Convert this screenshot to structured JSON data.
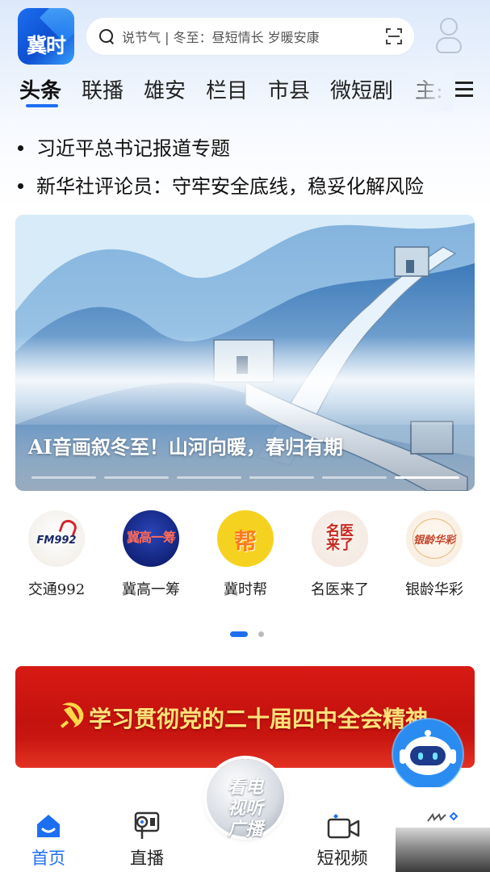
{
  "header": {
    "logo_text": "冀时",
    "search_placeholder": "说节气 | 冬至：昼短情长 岁暖安康",
    "search_icon": "search-icon",
    "scan_icon": "scan-icon",
    "profile_icon": "user-icon"
  },
  "tabs": [
    {
      "label": "头条",
      "active": true
    },
    {
      "label": "联播"
    },
    {
      "label": "雄安"
    },
    {
      "label": "栏目"
    },
    {
      "label": "市县"
    },
    {
      "label": "微短剧"
    },
    {
      "label": "主:"
    }
  ],
  "headlines": [
    "习近平总书记报道专题",
    "新华社评论员：守牢安全底线，稳妥化解风险"
  ],
  "banner": {
    "caption": "AI音画叙冬至！山河向暖，春归有期",
    "slides_total": 6,
    "active_slide": 6
  },
  "channels": [
    {
      "label": "交通992",
      "icon": "fm992-logo",
      "icon_text": "FM992"
    },
    {
      "label": "冀高一筹",
      "icon": "jigao-logo",
      "icon_text": "冀高一筹"
    },
    {
      "label": "冀时帮",
      "icon": "bang-logo",
      "icon_text": "帮"
    },
    {
      "label": "名医来了",
      "icon": "doctor-logo",
      "icon_text": "名医来了"
    },
    {
      "label": "银龄华彩",
      "icon": "silver-logo",
      "icon_text": "银龄华彩"
    }
  ],
  "channel_pages": {
    "total": 2,
    "active": 1
  },
  "promo": {
    "text": "学习贯彻党的二十届四中全会精神",
    "colors": {
      "background": "#c4120e",
      "text": "#ffe27a"
    }
  },
  "bottom_nav": {
    "items": [
      {
        "label": "首页",
        "icon": "home-icon",
        "active": true
      },
      {
        "label": "直播",
        "icon": "live-icon"
      },
      {
        "label": "看电视听广播",
        "icon": "tv-radio-icon"
      },
      {
        "label": "短视频",
        "icon": "video-icon"
      }
    ],
    "center_text": "看电视听广播"
  },
  "colors": {
    "accent": "#1d6ff2"
  }
}
